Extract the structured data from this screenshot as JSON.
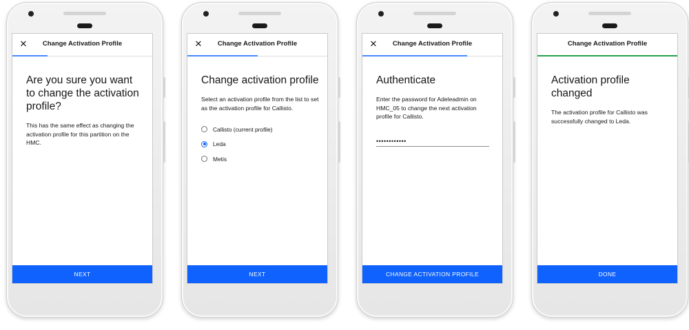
{
  "header_title": "Change Activation Profile",
  "close_glyph": "✕",
  "colors": {
    "primary": "#0f62fe",
    "progress": "#4589ff",
    "success": "#24a148"
  },
  "screens": [
    {
      "heading": "Are you sure you want to change the activation profile?",
      "body": "This has the same effect as changing the activation profile for this partition on the HMC.",
      "button": "NEXT",
      "progress": 0.25
    },
    {
      "heading": "Change activation profile",
      "body": "Select an activation profile from the list to set as the activation profile for Callisto.",
      "options": [
        {
          "label": "Callisto (current profile)",
          "selected": false
        },
        {
          "label": "Leda",
          "selected": true
        },
        {
          "label": "Metis",
          "selected": false
        }
      ],
      "button": "NEXT",
      "progress": 0.5
    },
    {
      "heading": "Authenticate",
      "body": "Enter the password for Adeleadmin on HMC_05 to change the next activation profile for Callisto.",
      "password_mask": "••••••••••••",
      "button": "CHANGE ACTIVATION PROFILE",
      "progress": 0.75
    },
    {
      "heading": "Activation profile changed",
      "body": "The activation profile for Callisto was successfully changed to Leda.",
      "button": "DONE",
      "progress": 1.0
    }
  ]
}
